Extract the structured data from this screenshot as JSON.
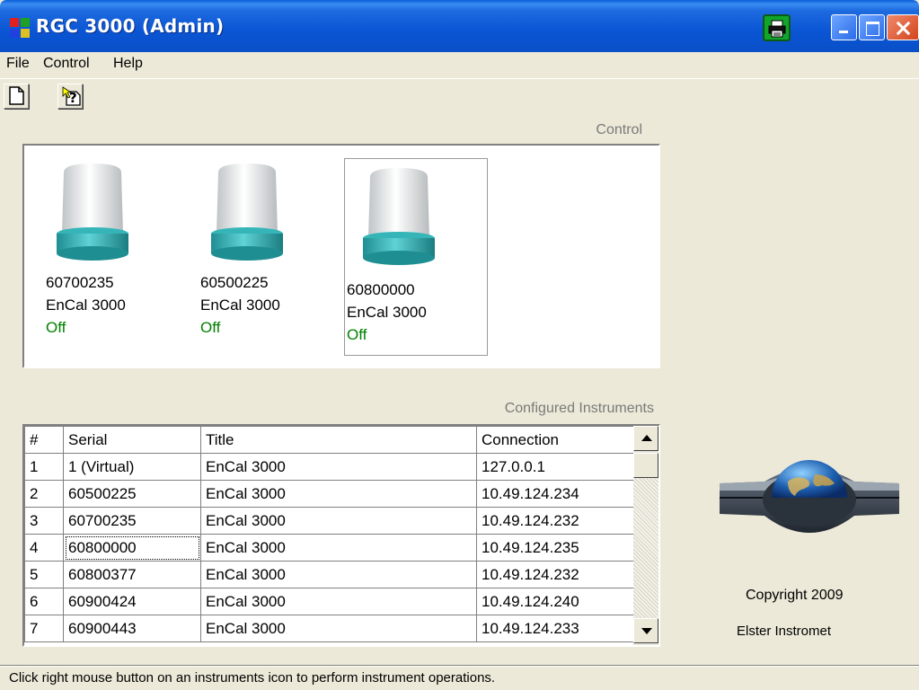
{
  "window": {
    "title": "RGC 3000 (Admin)",
    "controls": [
      "printer-icon",
      "minimize-icon",
      "maximize-icon",
      "close-icon"
    ]
  },
  "menu": {
    "items": [
      "File",
      "Control",
      "Help"
    ]
  },
  "toolbar": {
    "buttons": [
      "new-document-icon",
      "help-cursor-icon"
    ]
  },
  "control": {
    "label": "Control",
    "instruments": [
      {
        "serial": "60700235",
        "title": "EnCal 3000",
        "status": "Off",
        "selected": false
      },
      {
        "serial": "60500225",
        "title": "EnCal 3000",
        "status": "Off",
        "selected": false
      },
      {
        "serial": "60800000",
        "title": "EnCal 3000",
        "status": "Off",
        "selected": true
      }
    ]
  },
  "configured": {
    "label": "Configured Instruments",
    "columns": [
      "#",
      "Serial",
      "Title",
      "Connection"
    ],
    "rows": [
      [
        "1",
        "1 (Virtual)",
        "EnCal 3000",
        "127.0.0.1"
      ],
      [
        "2",
        "60500225",
        "EnCal 3000",
        "10.49.124.234"
      ],
      [
        "3",
        "60700235",
        "EnCal 3000",
        "10.49.124.232"
      ],
      [
        "4",
        "60800000",
        "EnCal 3000",
        "10.49.124.235"
      ],
      [
        "5",
        "60800377",
        "EnCal 3000",
        "10.49.124.232"
      ],
      [
        "6",
        "60900424",
        "EnCal 3000",
        "10.49.124.240"
      ],
      [
        "7",
        "60900443",
        "EnCal 3000",
        "10.49.124.233"
      ]
    ],
    "selected_row": 3
  },
  "copyright": "Copyright 2009",
  "company": "Elster Instromet",
  "status_text": "Click right mouse button on an instruments icon to perform instrument operations.",
  "colors": {
    "titlebar": "#0a55d4",
    "status_off": "#008000",
    "device_cap": "#f0f0f0",
    "device_base": "#35b5b8"
  }
}
